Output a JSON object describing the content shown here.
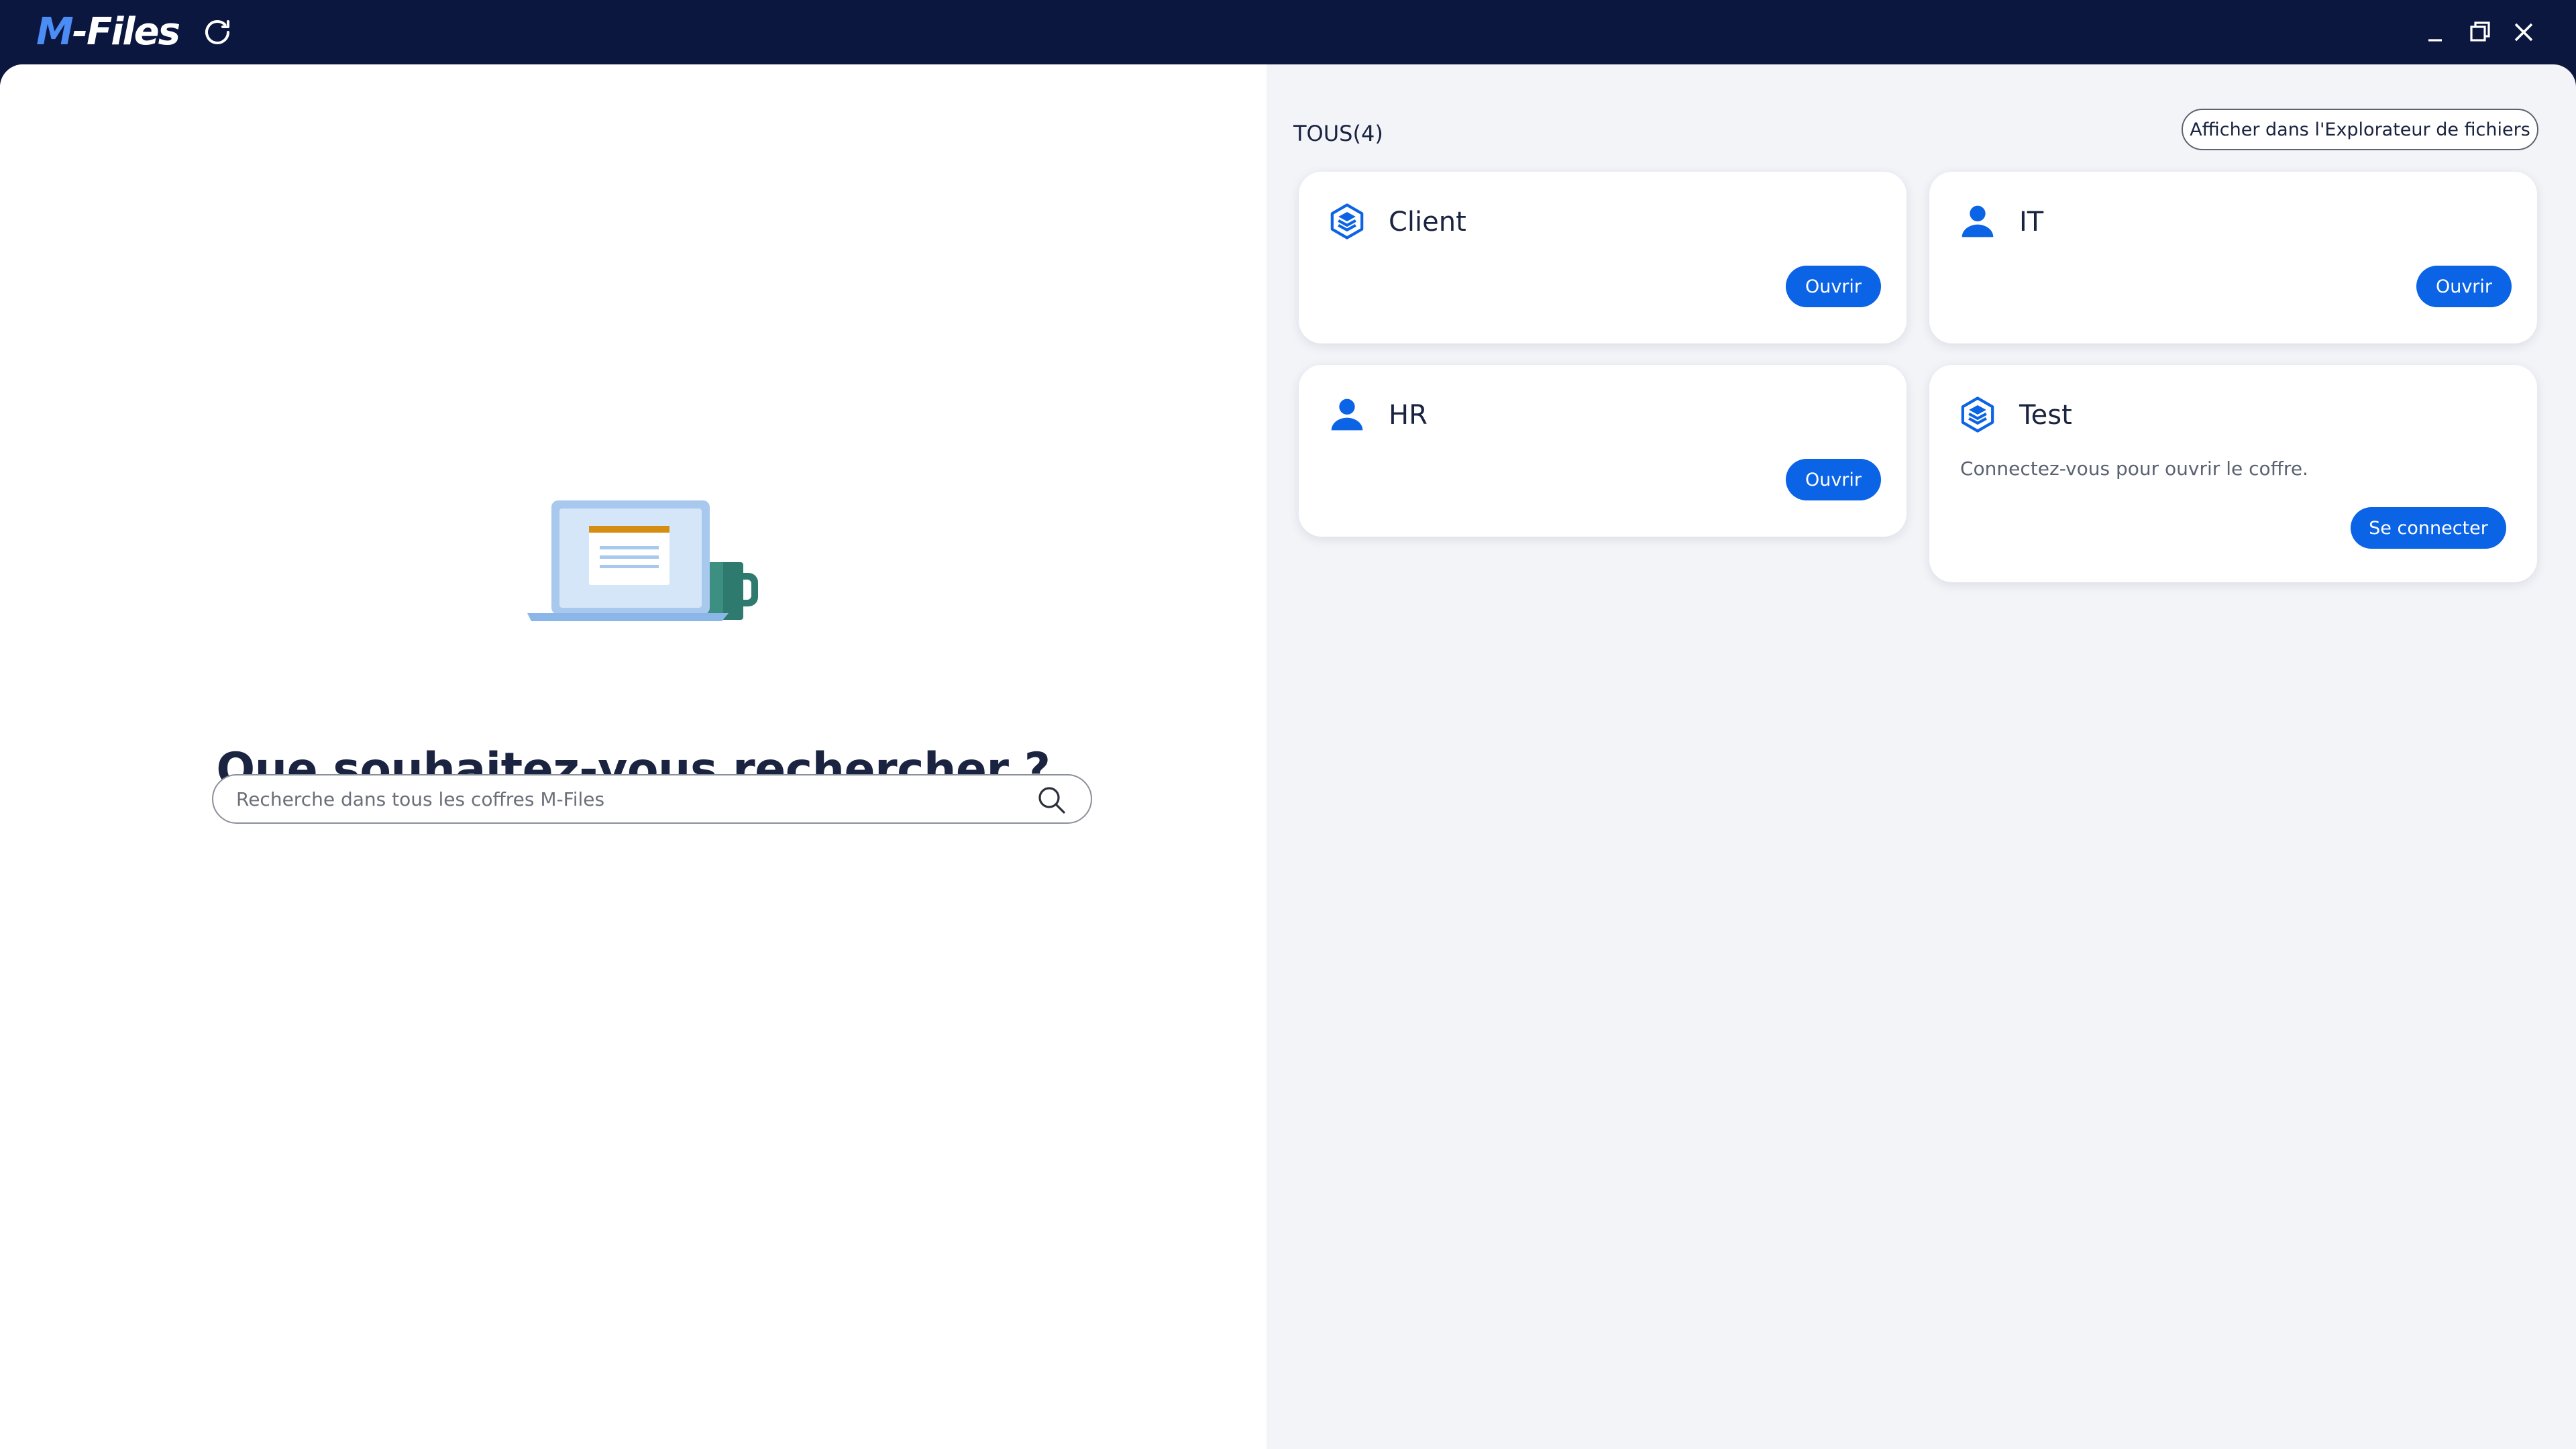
{
  "app": {
    "logo_m": "M",
    "logo_rest": "-Files"
  },
  "search": {
    "headline": "Que souhaitez-vous rechercher ?",
    "placeholder": "Recherche dans tous les coffres M-Files"
  },
  "vaults": {
    "filter_label": "TOUS(4)",
    "explorer_button": "Afficher dans l'Explorateur de fichiers",
    "items": [
      {
        "name": "Client",
        "icon": "vault-cube-icon",
        "action": "Ouvrir"
      },
      {
        "name": "IT",
        "icon": "user-icon",
        "action": "Ouvrir"
      },
      {
        "name": "HR",
        "icon": "user-icon",
        "action": "Ouvrir"
      },
      {
        "name": "Test",
        "icon": "vault-cube-icon",
        "description": "Connectez-vous pour ouvrir le coffre.",
        "action": "Se connecter"
      }
    ]
  },
  "colors": {
    "titlebar": "#0c1740",
    "accent": "#0b63e5",
    "logo_blue": "#4b8cf5",
    "panel_bg": "#f2f4f8"
  }
}
